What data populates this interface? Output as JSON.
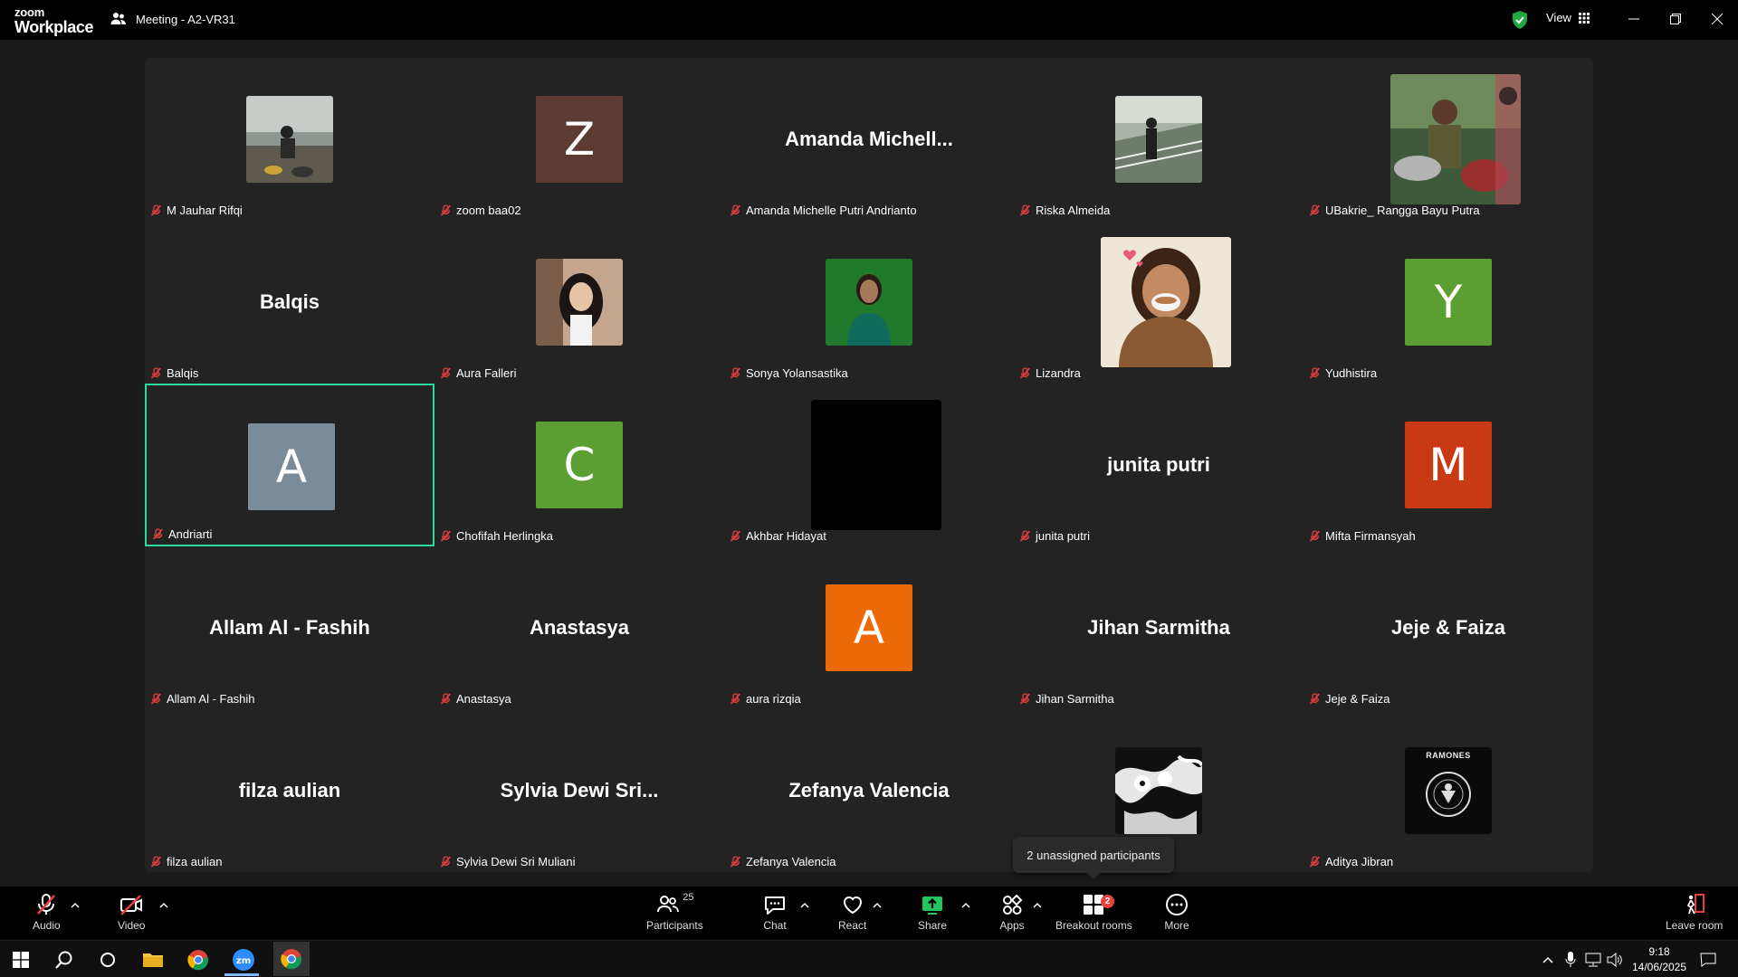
{
  "app": {
    "logo_line1": "zoom",
    "logo_line2": "Workplace",
    "meeting_title": "Meeting - A2-VR31",
    "view_label": "View"
  },
  "tiles": [
    {
      "name": "M Jauhar Rifqi",
      "kind": "photo",
      "photo": "person-motorbike"
    },
    {
      "name": "zoom baa02",
      "kind": "avatar",
      "letter": "Z",
      "color": "#5e3b32"
    },
    {
      "name": "Amanda Michelle Putri Andrianto",
      "kind": "text",
      "display": "Amanda  Michell..."
    },
    {
      "name": "Riska Almeida",
      "kind": "photo",
      "photo": "person-bridge"
    },
    {
      "name": "UBakrie_ Rangga Bayu Putra",
      "kind": "photo-big",
      "photo": "drummer"
    },
    {
      "name": "Balqis",
      "kind": "text",
      "display": "Balqis"
    },
    {
      "name": "Aura Falleri",
      "kind": "photo",
      "photo": "woman-portrait"
    },
    {
      "name": "Sonya Yolansastika",
      "kind": "photo",
      "photo": "woman-green"
    },
    {
      "name": "Lizandra",
      "kind": "photo-big",
      "photo": "cartoon-girl"
    },
    {
      "name": "Yudhistira",
      "kind": "avatar",
      "letter": "Y",
      "color": "#5b9e32"
    },
    {
      "name": "Andriarti",
      "kind": "avatar",
      "letter": "A",
      "color": "#7a8b99",
      "active": true
    },
    {
      "name": "Chofifah Herlingka",
      "kind": "avatar",
      "letter": "C",
      "color": "#5b9e32"
    },
    {
      "name": "Akhbar Hidayat",
      "kind": "photo-big",
      "photo": "black"
    },
    {
      "name": "junita putri",
      "kind": "text",
      "display": "junita putri"
    },
    {
      "name": "Mifta Firmansyah",
      "kind": "avatar",
      "letter": "M",
      "color": "#c93a14"
    },
    {
      "name": "Allam Al - Fashih",
      "kind": "text",
      "display": "Allam Al - Fashih"
    },
    {
      "name": "Anastasya",
      "kind": "text",
      "display": "Anastasya"
    },
    {
      "name": "aura rizqia",
      "kind": "avatar",
      "letter": "A",
      "color": "#ee6a07"
    },
    {
      "name": "Jihan Sarmitha",
      "kind": "text",
      "display": "Jihan Sarmitha"
    },
    {
      "name": "Jeje & Faiza",
      "kind": "text",
      "display": "Jeje & Faiza"
    },
    {
      "name": "filza aulian",
      "kind": "text",
      "display": "filza aulian"
    },
    {
      "name": "Sylvia Dewi Sri Muliani",
      "kind": "text",
      "display": "Sylvia  Dewi  Sri..."
    },
    {
      "name": "Zefanya Valencia",
      "kind": "text",
      "display": "Zefanya Valencia"
    },
    {
      "name": "",
      "kind": "photo",
      "photo": "abstract-bw"
    },
    {
      "name": "Aditya Jibran",
      "kind": "photo",
      "photo": "ramones-logo",
      "logo_text": "RAMONES"
    }
  ],
  "tooltip": "2 unassigned participants",
  "toolbar": {
    "audio": "Audio",
    "video": "Video",
    "participants": "Participants",
    "participants_count": "25",
    "chat": "Chat",
    "react": "React",
    "share": "Share",
    "apps": "Apps",
    "breakout": "Breakout rooms",
    "breakout_badge": "2",
    "more": "More",
    "leave": "Leave room"
  },
  "taskbar": {
    "time": "9:18",
    "date": "14/06/2025"
  },
  "colors": {
    "active_border": "#2bd9a2",
    "share_green": "#22c55e",
    "mute_red": "#e8413e"
  }
}
